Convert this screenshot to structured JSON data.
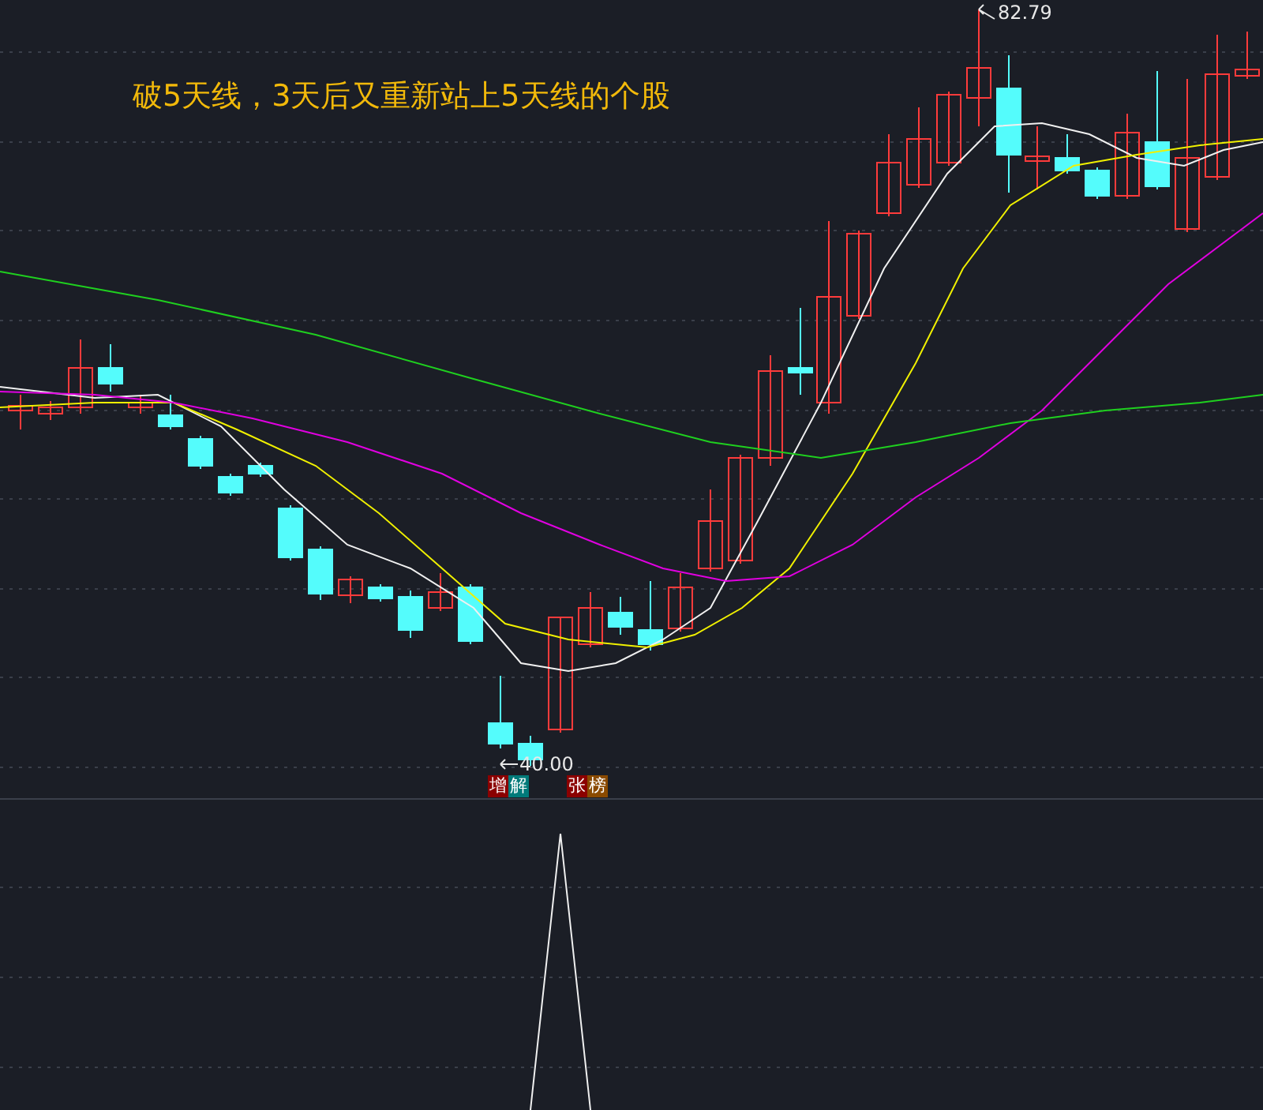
{
  "caption": "破5天线，3天后又重新站上5天线的个股",
  "high_label": "82.79",
  "low_label": "40.00",
  "signal_tags": [
    {
      "text": "增",
      "color": "#8b0000"
    },
    {
      "text": "解",
      "color": "#007a7a"
    },
    {
      "text": "张",
      "color": "#8b0000"
    },
    {
      "text": "榜",
      "color": "#8a4a00"
    }
  ]
}
